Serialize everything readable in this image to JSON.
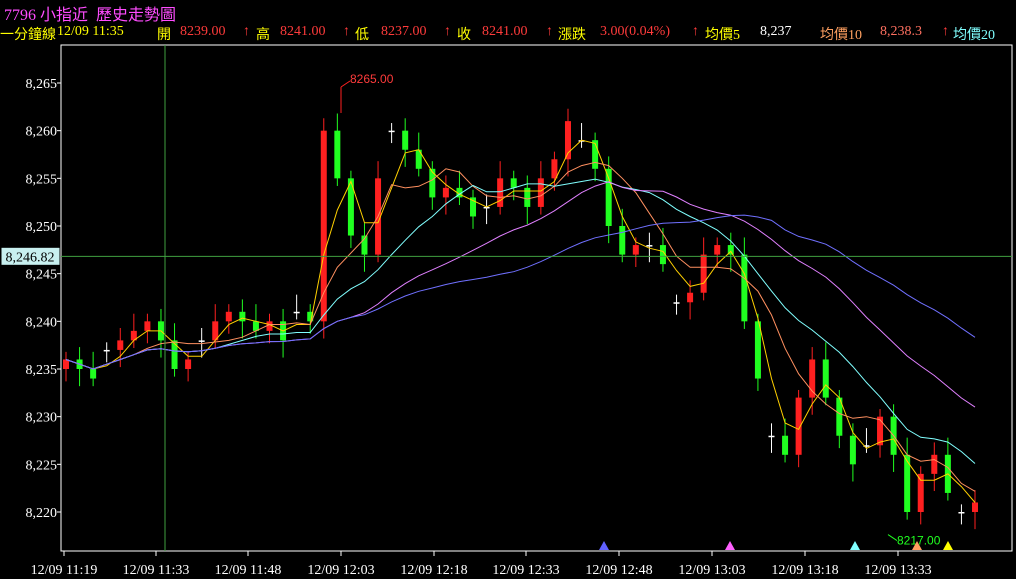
{
  "header": {
    "title": "7796 小指近  歷史走勢圖",
    "period": "一分鐘線",
    "datetime": "12/09 11:35",
    "open_label": "開",
    "open_value": "8239.00",
    "high_label": "高",
    "high_value": "8241.00",
    "low_label": "低",
    "low_value": "8237.00",
    "close_label": "收",
    "close_value": "8241.00",
    "change_label": "漲跌",
    "change_value": "3.00(0.04%)",
    "ma5_label": "均價5",
    "ma5_value": "8,237",
    "ma10_label": "均價10",
    "ma10_value": "8,238.3",
    "ma20_label": "均價20",
    "arrow": "↑"
  },
  "chart_data": {
    "type": "candlestick",
    "ylim": [
      8217,
      8266
    ],
    "y_ticks": [
      "8,265",
      "8,260",
      "8,255",
      "8,250",
      "8,245",
      "8,240",
      "8,235",
      "8,230",
      "8,225",
      "8,220"
    ],
    "y_tick_values": [
      8265,
      8260,
      8255,
      8250,
      8245,
      8240,
      8235,
      8230,
      8225,
      8220
    ],
    "x_ticks": [
      "12/09 11:19",
      "12/09 11:33",
      "12/09 11:48",
      "12/09 12:03",
      "12/09 12:18",
      "12/09 12:33",
      "12/09 12:48",
      "12/09 13:03",
      "12/09 13:18",
      "12/09 13:33"
    ],
    "crosshair_price": "8,246.82",
    "crosshair_price_value": 8246.82,
    "high_annotation": "8265.00",
    "high_annotation_value": 8265,
    "low_annotation": "8217.00",
    "low_annotation_value": 8217,
    "close_sample": [
      8236,
      8235,
      8234,
      8237,
      8238,
      8239,
      8240,
      8238,
      8235,
      8236,
      8238,
      8240,
      8241,
      8240,
      8239,
      8240,
      8238,
      8241,
      8240,
      8260,
      8255,
      8249,
      8247,
      8255,
      8260,
      8258,
      8256,
      8253,
      8254,
      8253,
      8251,
      8252,
      8255,
      8254,
      8252,
      8255,
      8257,
      8261,
      8259,
      8256,
      8250,
      8247,
      8248,
      8248,
      8246,
      8242,
      8243,
      8247,
      8248,
      8247,
      8240,
      8234,
      8228,
      8226,
      8232,
      8236,
      8232,
      8228,
      8225,
      8227,
      8230,
      8226,
      8220,
      8224,
      8226,
      8222,
      8220,
      8221
    ],
    "series": [
      {
        "name": "均價5",
        "color": "#ffd000"
      },
      {
        "name": "均價10",
        "color": "#ff9060"
      },
      {
        "name": "均價20",
        "color": "#80ffff"
      }
    ],
    "markers": [
      {
        "color": "#6060ff"
      },
      {
        "color": "#ff60ff"
      },
      {
        "color": "#80ffff"
      },
      {
        "color": "#ffa060"
      },
      {
        "color": "#ffff00"
      }
    ]
  }
}
